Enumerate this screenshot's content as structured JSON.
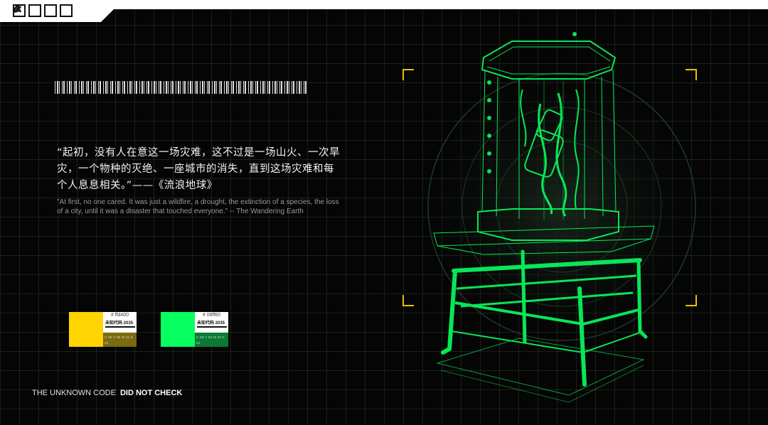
{
  "toolbar": {
    "icons": [
      "recycle-icon",
      "help-icon",
      "pill-icon",
      "qr-code-icon"
    ]
  },
  "quote": {
    "chinese": "“起初，没有人在意这一场灾难，这不过是一场山火、一次旱灾，一个物种的灭绝、一座城市的消失，直到这场灾难和每个人息息相关。”——《流浪地球》",
    "english": "\"At first, no one cared. It was just a wildfire, a drought, the extinction of a species, the loss of a city, until it was a disaster that touched everyone.\" -- The Wandering Earth"
  },
  "swatches": [
    {
      "hex": "# ffd400",
      "color": "#ffd400",
      "foot_color": "#7a6a10",
      "brand": "未知代码 2035",
      "codes": "C 05 Y 85 M 21 K 01"
    },
    {
      "hex": "# 08ff60",
      "color": "#08ff60",
      "foot_color": "#0b7a34",
      "brand": "未知代码 2035",
      "codes": "C 60 Y 82 M 00 K 01"
    }
  ],
  "footer": {
    "title": "THE UNKNOWN CODE",
    "status": "DID NOT CHECK"
  },
  "colors": {
    "accent_green": "#08ff60",
    "accent_yellow": "#e6c200",
    "grid": "#3c5a3c"
  }
}
